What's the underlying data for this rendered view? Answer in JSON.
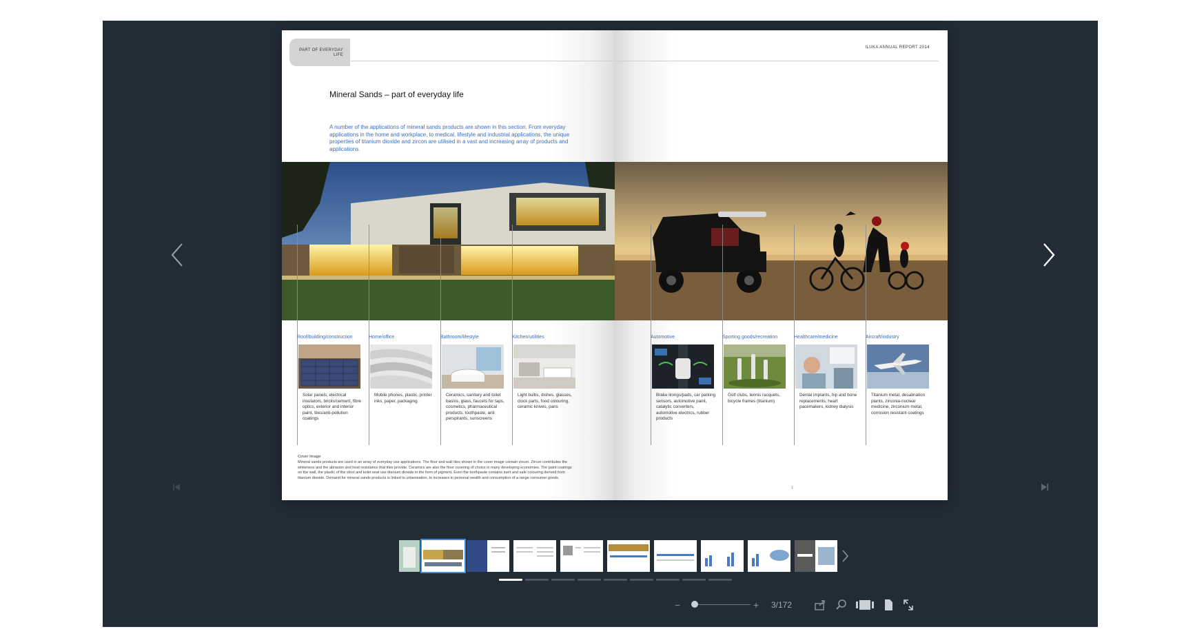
{
  "left_page": {
    "section_tab": "PART OF EVERYDAY LIFE",
    "heading": "Mineral Sands – part of everyday life",
    "intro": "A number of the applications of mineral sands products are shown in this section. From everyday applications in the home and workplace, to medical, lifestyle and industrial applications, the unique properties of titanium dioxide and zircon are utilised in a vast and increasing array of products and applications.",
    "categories": [
      {
        "title": "Roof/building/construction",
        "text": "Solar panels, electrical insulators, bricks/cement, fibre optics, exterior and interior paint, tiles/anti-pollution coatings"
      },
      {
        "title": "Home/office",
        "text": "Mobile phones, plastic, printer inks, paper, packaging"
      },
      {
        "title": "Bathroom/lifestyle",
        "text": "Ceramics, sanitary and toilet basins, glass, faucets for taps, cosmetics, pharmaceutical products, toothpaste, anti perspirants, sunscreens"
      },
      {
        "title": "Kitchen/utilities",
        "text": "Light bulbs, dishes, glasses, clock parts, food colouring, ceramic knives, pans"
      }
    ],
    "cover_title": "Cover Image:",
    "cover_text": "Mineral sands products are used in an array of everyday use applications. The floor and wall tiles shown in the cover image contain zircon. Zircon contributes the whiteness and the abrasion and heat resistance that tiles provide. Ceramics are also the floor covering of choice in many developing economies. The paint coatings on the wall, the plastic of the stool and toilet seat use titanium dioxide in the form of pigment. Even the toothpaste contains inert and safe colouring derived from titanium dioxide. Demand for mineral sands products is linked to urbanisation, to increases in personal wealth and consumption of a range consumer goods."
  },
  "right_page": {
    "report_title": "ILUKA ANNUAL REPORT 2014",
    "page_number": "1",
    "categories": [
      {
        "title": "Automotive",
        "text": "Brake linings/pads, car parking sensors, automotive paint, catalytic converters, automotive electrics, rubber products"
      },
      {
        "title": "Sporting goods/recreation",
        "text": "Golf clubs, tennis racquets, bicycle frames (titanium)"
      },
      {
        "title": "Healthcare/medicine",
        "text": "Dental implants, hip and bone replacements, heart pacemakers, kidney dialysis"
      },
      {
        "title": "Aircraft/industry",
        "text": "Titanium metal, desalination plants, zirconia-nuclear medicine, zirconium metal, corrosion resistant coatings"
      }
    ]
  },
  "toolbar": {
    "zoom_out": "−",
    "zoom_in": "+",
    "page_count": "3/172"
  },
  "icons": [
    "prev-page-icon",
    "next-page-icon",
    "first-page-icon",
    "last-page-icon",
    "thumbnail-next-icon",
    "share-icon",
    "search-icon",
    "thumbnail-view-icon",
    "single-page-icon",
    "fullscreen-icon"
  ],
  "colors": {
    "viewer_bg": "#222c36",
    "accent_blue": "#3d6db8",
    "selected_thumb": "#3b8fe0"
  }
}
